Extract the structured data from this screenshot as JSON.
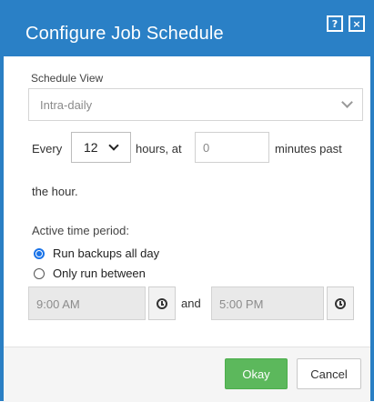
{
  "dialog": {
    "title": "Configure Job Schedule",
    "help_icon": "?",
    "close_icon": "×"
  },
  "schedule_view": {
    "label": "Schedule View",
    "value": "Intra-daily"
  },
  "interval": {
    "every_label": "Every",
    "hours_value": "12",
    "hours_label": "hours, at",
    "minutes_value": "0",
    "minutes_label": "minutes past",
    "hour_label": "the hour."
  },
  "active_period": {
    "label": "Active time period:",
    "option_all_day": "Run backups all day",
    "option_between": "Only run between",
    "selected": "all_day",
    "start_time": "9:00 AM",
    "and_label": "and",
    "end_time": "5:00 PM"
  },
  "footer": {
    "okay_label": "Okay",
    "cancel_label": "Cancel"
  },
  "colors": {
    "titlebar": "#2a80c6",
    "okay": "#5cb85c",
    "radio_selected": "#1a73e8"
  }
}
